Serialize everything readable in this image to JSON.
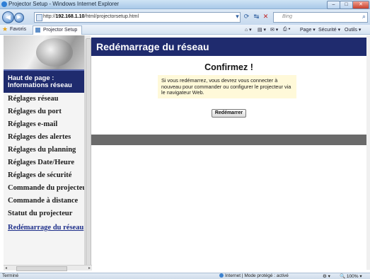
{
  "window": {
    "title": "Projector Setup - Windows Internet Explorer",
    "minimize": "–",
    "maximize": "□",
    "close": "✕"
  },
  "addressbar": {
    "url_prefix": "http://",
    "url_host": "192.168.1.10",
    "url_path": "/html/projectorsetup.html",
    "search_placeholder": "Bing"
  },
  "favbar": {
    "favorites_label": "Favoris",
    "tab_label": "Projector Setup",
    "commands": [
      "Page ▾",
      "Sécurité ▾",
      "Outils ▾"
    ]
  },
  "sidebar": {
    "header": "Haut de page : Informations réseau",
    "items": [
      {
        "label": "Réglages réseau"
      },
      {
        "label": "Réglages du port"
      },
      {
        "label": "Réglages e-mail"
      },
      {
        "label": "Réglages des alertes"
      },
      {
        "label": "Réglages du planning"
      },
      {
        "label": "Réglages Date/Heure"
      },
      {
        "label": "Réglages de sécurité"
      },
      {
        "label": "Commande du projecteur"
      },
      {
        "label": "Commande à distance"
      },
      {
        "label": "Statut du projecteur"
      },
      {
        "label": "Redémarrage du réseau",
        "active": true
      }
    ]
  },
  "main": {
    "title": "Redémarrage du réseau",
    "confirm_title": "Confirmez !",
    "confirm_message": "Si vous redémarrez, vous devrez vous connecter à nouveau pour commander ou configurer le projecteur via le navigateur Web.",
    "restart_button": "Redémarrer"
  },
  "statusbar": {
    "left": "Terminé",
    "zone": "Internet | Mode protégé : activé",
    "zoom": "100%"
  }
}
